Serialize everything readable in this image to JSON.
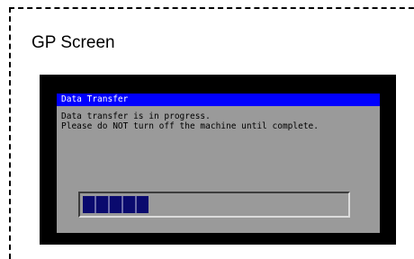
{
  "caption": "GP Screen",
  "dialog": {
    "title": "Data Transfer",
    "message_line1": "Data transfer is in progress.",
    "message_line2": "Please do NOT turn off the machine until complete."
  },
  "progress": {
    "fraction": 0.25,
    "segments_filled": 5
  },
  "colors": {
    "titlebar": "#0000ff",
    "dialog_bg": "#9a9a9a",
    "screen_bg": "#000000",
    "progress_fill": "#0a0a6e"
  }
}
